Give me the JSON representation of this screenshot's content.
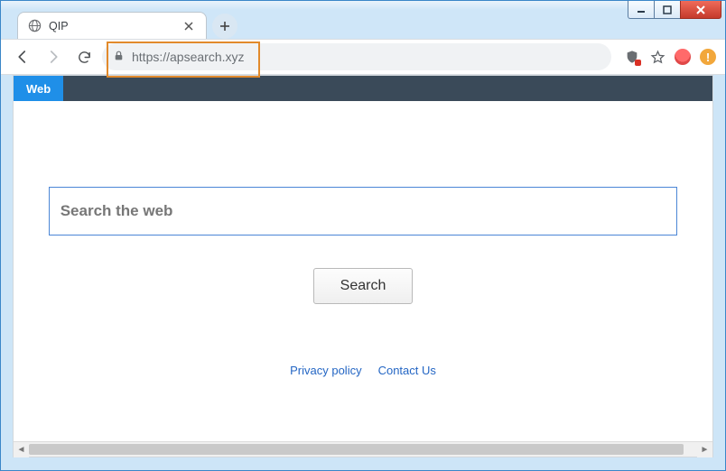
{
  "window": {
    "controls": {
      "min": "minimize",
      "max": "maximize",
      "close": "close"
    }
  },
  "browser": {
    "tab_title": "QIP",
    "url": "https://apsearch.xyz",
    "nav": {
      "back": "Back",
      "forward": "Forward",
      "reload": "Reload"
    },
    "icons": {
      "shield": "privacy-shield-icon",
      "star": "bookmark-star-icon",
      "avatar": "profile-avatar",
      "warn": "!"
    }
  },
  "page": {
    "nav_tab": "Web",
    "search_placeholder": "Search the web",
    "search_value": "",
    "search_button": "Search",
    "footer": {
      "privacy": "Privacy policy",
      "contact": "Contact Us"
    }
  },
  "annotation": {
    "highlight": "address-bar-highlight"
  }
}
